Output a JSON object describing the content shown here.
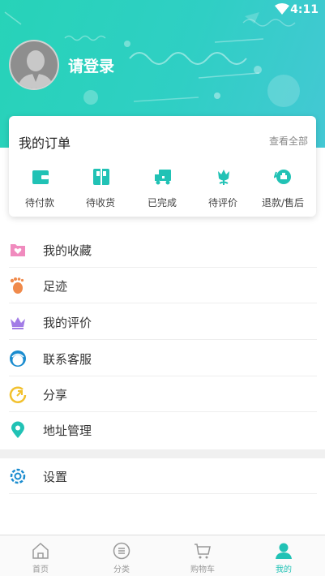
{
  "status_bar": {
    "time": "4:11"
  },
  "profile": {
    "login_label": "请登录"
  },
  "orders": {
    "title": "我的订单",
    "view_all": "查看全部",
    "items": [
      {
        "label": "待付款",
        "icon": "wallet-icon"
      },
      {
        "label": "待收货",
        "icon": "package-icon"
      },
      {
        "label": "已完成",
        "icon": "truck-icon"
      },
      {
        "label": "待评价",
        "icon": "flower-icon"
      },
      {
        "label": "退款/售后",
        "icon": "refund-icon"
      }
    ]
  },
  "menu": [
    {
      "label": "我的收藏",
      "icon": "heart-folder-icon"
    },
    {
      "label": "足迹",
      "icon": "footprint-icon"
    },
    {
      "label": "我的评价",
      "icon": "crown-icon"
    },
    {
      "label": "联系客服",
      "icon": "customer-service-icon"
    },
    {
      "label": "分享",
      "icon": "share-icon"
    },
    {
      "label": "地址管理",
      "icon": "location-pin-icon"
    }
  ],
  "settings": {
    "label": "设置",
    "icon": "gear-icon"
  },
  "tabbar": [
    {
      "label": "首页",
      "icon": "home-icon",
      "active": false
    },
    {
      "label": "分类",
      "icon": "category-icon",
      "active": false
    },
    {
      "label": "购物车",
      "icon": "cart-icon",
      "active": false
    },
    {
      "label": "我的",
      "icon": "person-icon",
      "active": true
    }
  ],
  "colors": {
    "accent": "#21c2b5",
    "header_start": "#27d3b8",
    "header_end": "#44c8d4"
  }
}
